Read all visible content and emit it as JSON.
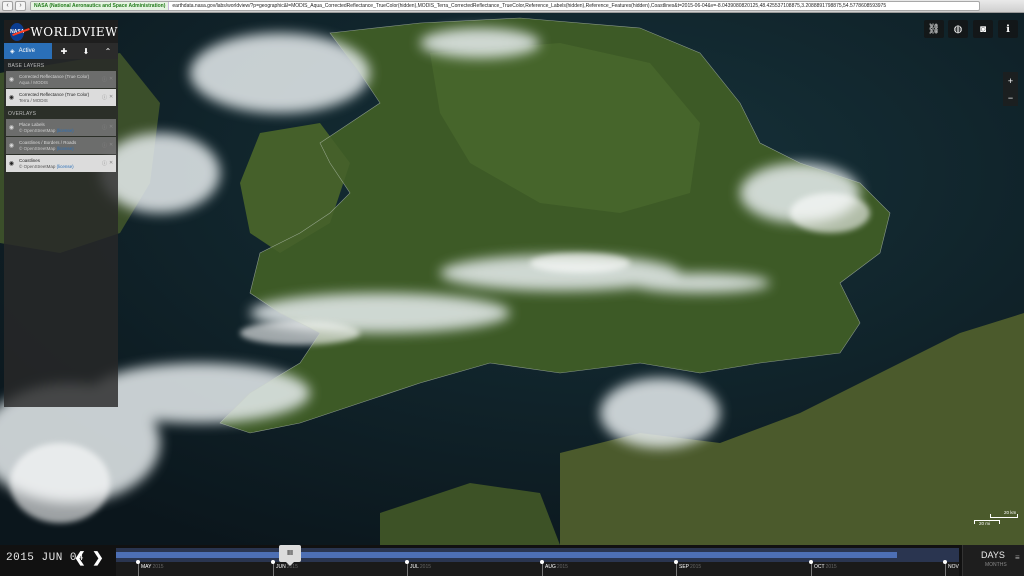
{
  "browser": {
    "site_badge": "NASA (National Aeronautics and Space Administration)",
    "url": "earthdata.nasa.gov/labs/worldview/?p=geographic&l=MODIS_Aqua_CorrectedReflectance_TrueColor(hidden),MODIS_Terra_CorrectedReflectance_TrueColor,Reference_Labels(hidden),Reference_Features(hidden),Coastlines&t=2015-06-04&v=-8.0439080820125,48.425537108875,3.2088891798875,54.5778608593975",
    "back_icon": "arrow-left-icon",
    "forward_icon": "arrow-right-icon"
  },
  "app": {
    "name": "WORLDVIEW",
    "logo_text": "NASA"
  },
  "tabs": {
    "active_label": "Active"
  },
  "sections": {
    "base_layers": "BASE LAYERS",
    "overlays": "OVERLAYS"
  },
  "base_layers": [
    {
      "title": "Corrected Reflectance (True Color)",
      "subtitle": "Aqua / MODIS",
      "visible": false
    },
    {
      "title": "Corrected Reflectance (True Color)",
      "subtitle": "Terra / MODIS",
      "visible": true
    }
  ],
  "overlays": [
    {
      "title": "Place Labels",
      "subtitle": "© OpenStreetMap",
      "license": "(license)",
      "visible": false
    },
    {
      "title": "Coastlines / Borders / Roads",
      "subtitle": "© OpenStreetMap",
      "license": "(license)",
      "visible": false
    },
    {
      "title": "Coastlines",
      "subtitle": "© OpenStreetMap",
      "license": "(license)",
      "visible": true
    }
  ],
  "toolbar": {
    "link_icon": "link-icon",
    "globe_icon": "globe-icon",
    "camera_icon": "camera-icon",
    "info_icon": "info-icon"
  },
  "zoom": {
    "in": "+",
    "out": "−"
  },
  "scale": {
    "km": "20 km",
    "mi": "20 mi"
  },
  "timeline": {
    "date": "2015 JUN 04",
    "months": [
      {
        "label": "MAY",
        "year": "2015"
      },
      {
        "label": "JUN",
        "year": "2015"
      },
      {
        "label": "JUL",
        "year": "2015"
      },
      {
        "label": "AUG",
        "year": "2015"
      },
      {
        "label": "SEP",
        "year": "2015"
      },
      {
        "label": "OCT",
        "year": "2015"
      },
      {
        "label": "NOV",
        "year": ""
      }
    ],
    "handle_glyph": "III",
    "zoom_level": "DAYS",
    "zoom_alt": "MONTHS",
    "zoom_menu_icon": "menu-icon",
    "fill_fraction": 0.926
  },
  "colors": {
    "accent": "#2a6fb8",
    "timeline_track": "#4d6fb5",
    "land": "#3d5a26",
    "sea": "#0e1d24"
  }
}
